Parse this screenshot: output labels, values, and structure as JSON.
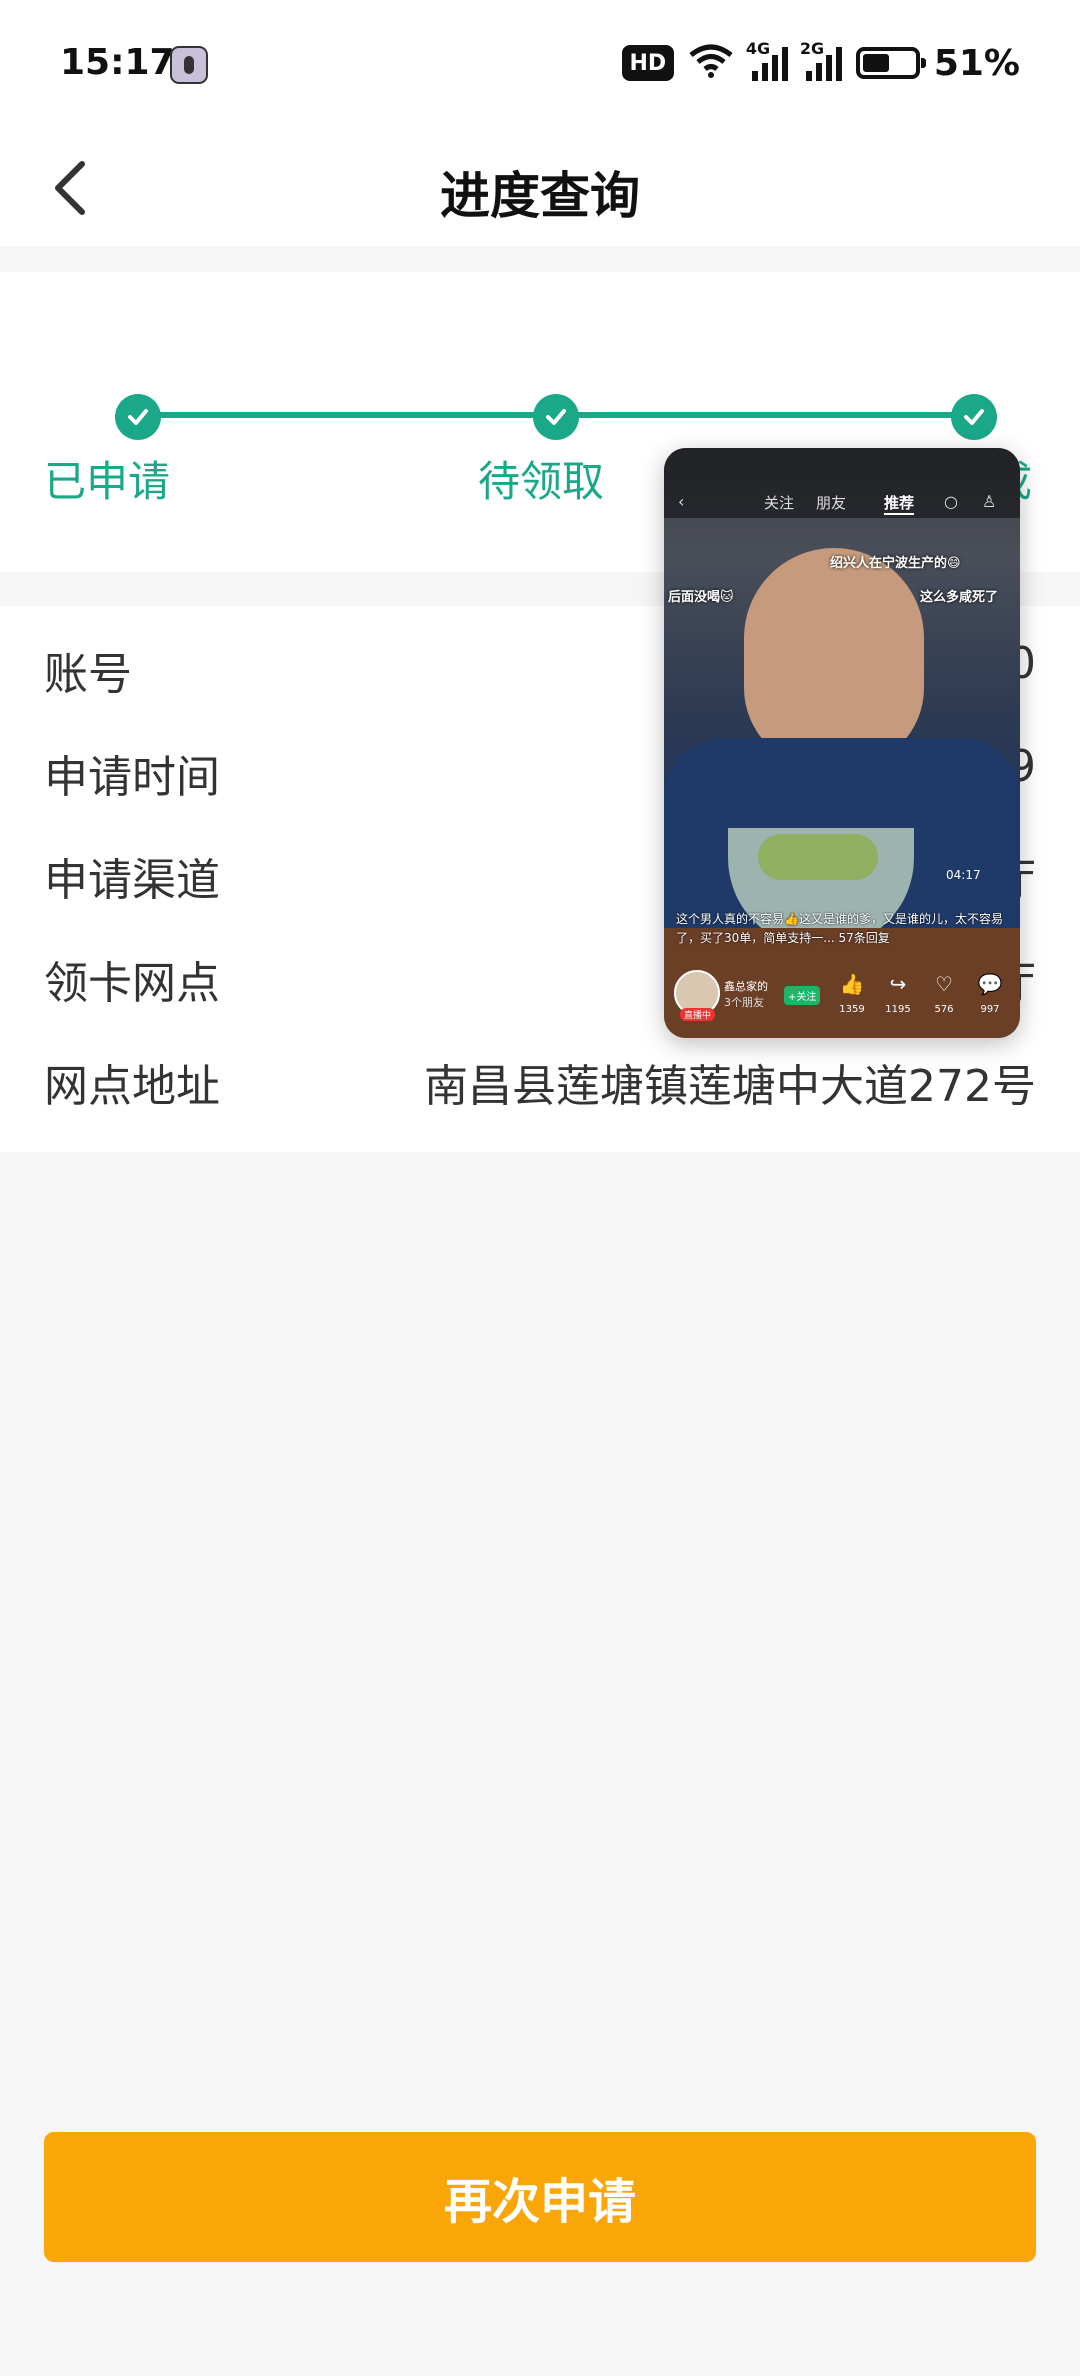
{
  "status_bar": {
    "time": "15:17",
    "hd_label": "HD",
    "network1": "4G",
    "network2": "2G",
    "battery": "51%"
  },
  "header": {
    "title": "进度查询",
    "back_icon": "chevron-left-icon"
  },
  "progress": {
    "color": "#1aa889",
    "steps": [
      {
        "label": "已申请",
        "done": true
      },
      {
        "label": "待领取",
        "done": true
      },
      {
        "label": "成",
        "done": true
      }
    ]
  },
  "info": {
    "rows": [
      {
        "label": "账号",
        "value": "0"
      },
      {
        "label": "申请时间",
        "value": "9"
      },
      {
        "label": "申请渠道",
        "value": "厅"
      },
      {
        "label": "领卡网点",
        "value": "厅"
      },
      {
        "label": "网点地址",
        "value": "南昌县莲塘镇莲塘中大道272号"
      }
    ]
  },
  "video_overlay": {
    "tabs": [
      "关注",
      "朋友",
      "推荐"
    ],
    "caption_top": "绍兴人在宁波生产的😄",
    "caption_left": "后面没喝🐱",
    "caption_right": "这么多咸死了",
    "duration": "04:17",
    "description": "这个男人真的不容易👍这又是谁的爹，又是谁的儿，太不容易了，买了30单，简单支持一... 57条回复",
    "author": "鑫总家的",
    "friends": "3个朋友",
    "follow": "+关注",
    "live": "直播中",
    "stats": [
      {
        "icon": "thumbs-up-icon",
        "glyph": "👍",
        "count": "1359"
      },
      {
        "icon": "share-icon",
        "glyph": "↪",
        "count": "1195"
      },
      {
        "icon": "heart-icon",
        "glyph": "♡",
        "count": "576"
      },
      {
        "icon": "comment-icon",
        "glyph": "💬",
        "count": "997"
      }
    ]
  },
  "actions": {
    "reapply": "再次申请",
    "button_color": "#fba608"
  }
}
